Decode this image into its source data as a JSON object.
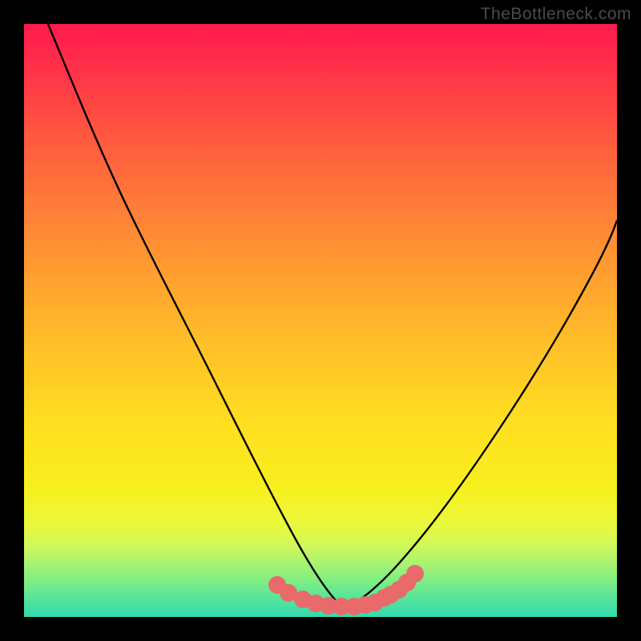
{
  "watermark": "TheBottleneck.com",
  "chart_data": {
    "type": "line",
    "title": "",
    "xlabel": "",
    "ylabel": "",
    "xlim": [
      0,
      100
    ],
    "ylim": [
      0,
      100
    ],
    "background_gradient": {
      "direction": "vertical",
      "stops": [
        {
          "pos": 0,
          "color": "#ff1a4d"
        },
        {
          "pos": 18,
          "color": "#ff5540"
        },
        {
          "pos": 42,
          "color": "#ff9e30"
        },
        {
          "pos": 68,
          "color": "#ffe020"
        },
        {
          "pos": 84,
          "color": "#ecf83a"
        },
        {
          "pos": 94,
          "color": "#7ded85"
        },
        {
          "pos": 100,
          "color": "#33d9af"
        }
      ]
    },
    "series": [
      {
        "name": "left-curve",
        "color": "#000000",
        "x": [
          4,
          7,
          10,
          13,
          16,
          19,
          22,
          25,
          28,
          31,
          34,
          37,
          40,
          43,
          46,
          49,
          52,
          55
        ],
        "y": [
          100,
          93,
          86,
          79,
          72,
          65,
          58,
          51.5,
          45,
          38.8,
          33,
          27.5,
          22.5,
          18,
          14,
          10.5,
          7.5,
          5
        ]
      },
      {
        "name": "right-curve",
        "color": "#000000",
        "x": [
          55,
          58,
          61,
          64,
          67,
          70,
          73,
          76,
          79,
          82,
          85,
          88,
          91,
          94,
          97,
          100
        ],
        "y": [
          5,
          6.5,
          9,
          12,
          15.5,
          19.5,
          24,
          29,
          34,
          39.5,
          45,
          51,
          57,
          63.5,
          70,
          77
        ]
      },
      {
        "name": "highlight-points",
        "color": "#e86a6a",
        "marker_size": 11,
        "x": [
          42.5,
          44.5,
          47,
          49,
          51,
          53,
          55,
          57,
          58.5,
          60,
          61,
          62.5,
          64,
          65.5
        ],
        "y": [
          4.8,
          4.2,
          3.6,
          3.2,
          3.0,
          3.0,
          3.0,
          3.2,
          3.5,
          4.0,
          4.5,
          5.2,
          6.2,
          7.5
        ]
      }
    ]
  }
}
